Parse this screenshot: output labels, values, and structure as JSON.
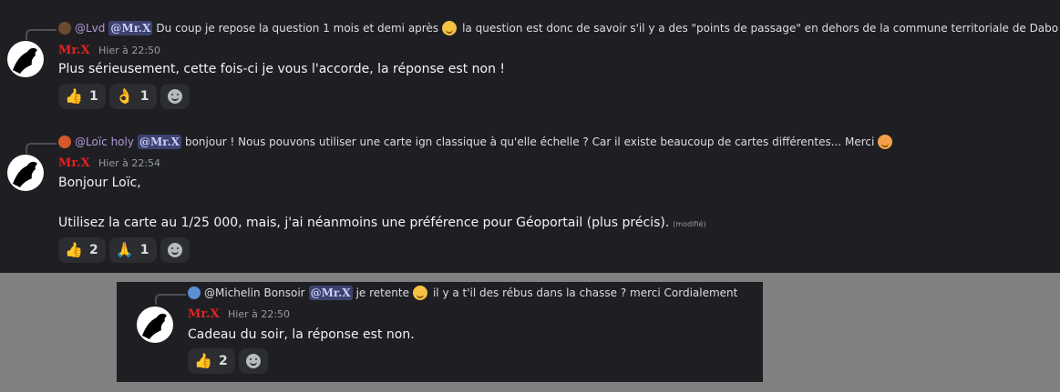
{
  "messages": [
    {
      "reply": {
        "replier": "@Lvd",
        "mention": "@Mr.X",
        "text_before": "Du coup je repose la question 1 mois et demi après",
        "text_after": "la question est donc de savoir s'il y a des \"points de passage\" en dehors de la commune territoriale de Dabo ?",
        "emoji_icon": "smiling-face-emoji"
      },
      "author": "Mr.X",
      "time": "Hier à 22:50",
      "lines": [
        "Plus sérieusement, cette fois-ci je vous l'accorde, la réponse est non !"
      ],
      "reactions": [
        {
          "icon": "thumbs-up-emoji",
          "glyph": "👍",
          "count": "1"
        },
        {
          "icon": "ok-hand-emoji",
          "glyph": "👌",
          "count": "1"
        }
      ]
    },
    {
      "reply": {
        "replier": "@Loïc holy",
        "mention": "@Mr.X",
        "text_before": "bonjour !  Nous pouvons utiliser une carte ign classique à qu'elle échelle ? Car il existe beaucoup de cartes différentes...  Merci",
        "text_after": "",
        "emoji_icon": "blushing-face-emoji"
      },
      "author": "Mr.X",
      "time": "Hier à 22:54",
      "lines": [
        "Bonjour Loïc,",
        "Utilisez la carte au 1/25 000, mais, j'ai néanmoins une préférence pour Géoportail (plus précis)."
      ],
      "edited": "(modifié)",
      "reactions": [
        {
          "icon": "thumbs-up-emoji",
          "glyph": "👍",
          "count": "2"
        },
        {
          "icon": "folded-hands-emoji",
          "glyph": "🙏",
          "count": "1"
        }
      ]
    },
    {
      "reply": {
        "replier": "@Michelin",
        "text_pre": "Bonsoir",
        "mention": "@Mr.X",
        "text_before": "je retente",
        "text_after": "il y a t'il des rébus dans la chasse ? merci  Cordialement",
        "emoji_icon": "sweat-smile-emoji"
      },
      "author": "Mr.X",
      "time": "Hier à 22:50",
      "lines": [
        "Cadeau du soir, la réponse est non."
      ],
      "reactions": [
        {
          "icon": "thumbs-up-emoji",
          "glyph": "👍",
          "count": "2"
        }
      ]
    }
  ]
}
